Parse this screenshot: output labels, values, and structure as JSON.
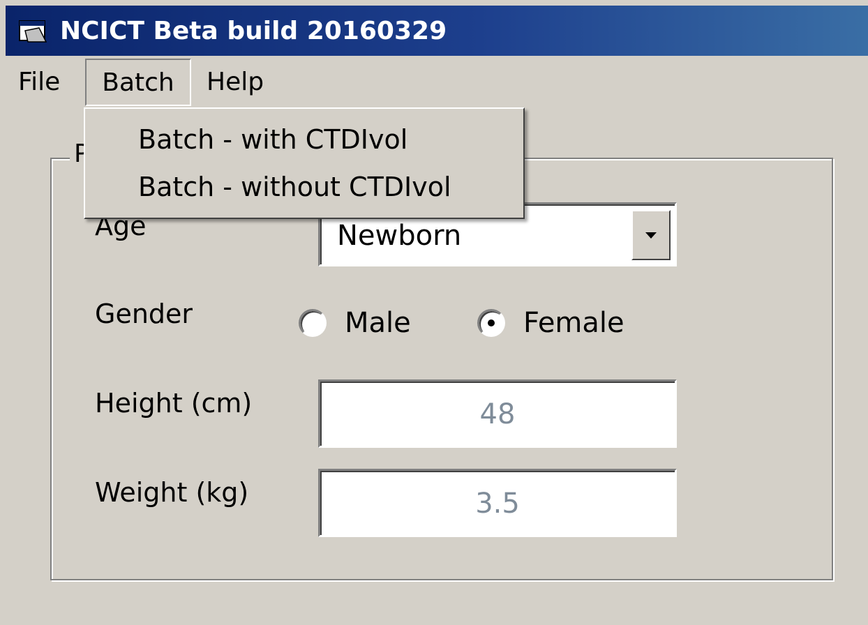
{
  "window": {
    "title": "NCICT Beta build 20160329",
    "icon": "app-window-icon",
    "accent": "#0a246a"
  },
  "menubar": {
    "items": [
      {
        "label": "File"
      },
      {
        "label": "Batch",
        "open": true
      },
      {
        "label": "Help"
      }
    ]
  },
  "batch_menu": {
    "items": [
      {
        "label": "Batch - with CTDIvol"
      },
      {
        "label": "Batch - without CTDIvol"
      }
    ]
  },
  "patient": {
    "group_caption": "P",
    "age": {
      "label": "Age",
      "value": "Newborn"
    },
    "gender": {
      "label": "Gender",
      "options": [
        {
          "label": "Male",
          "selected": false
        },
        {
          "label": "Female",
          "selected": true
        }
      ]
    },
    "height": {
      "label": "Height (cm)",
      "value": "48"
    },
    "weight": {
      "label": "Weight (kg)",
      "value": "3.5"
    }
  }
}
